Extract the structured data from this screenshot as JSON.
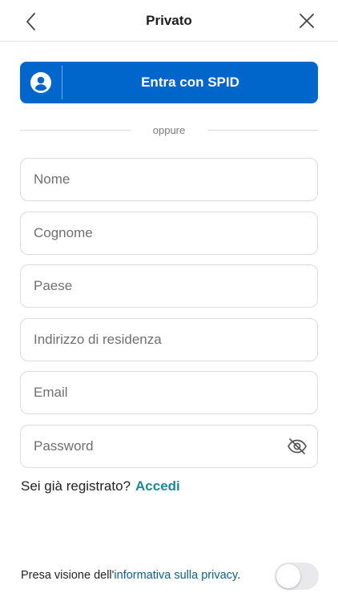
{
  "header": {
    "title": "Privato",
    "back_icon": "chevron-left-icon",
    "close_icon": "close-icon"
  },
  "spid": {
    "label": "Entra con SPID",
    "icon": "user-circle-icon",
    "color": "#0066cc"
  },
  "separator": {
    "text": "oppure"
  },
  "form": {
    "nome_placeholder": "Nome",
    "cognome_placeholder": "Cognome",
    "paese_placeholder": "Paese",
    "indirizzo_placeholder": "Indirizzo di residenza",
    "email_placeholder": "Email",
    "password_placeholder": "Password",
    "password_toggle_icon": "eye-slash-icon"
  },
  "login": {
    "prompt": "Sei già registrato?",
    "link": "Accedi"
  },
  "privacy": {
    "prefix": "Presa visione dell'",
    "link": "informativa sulla privacy",
    "suffix": ".",
    "toggle_on": false
  }
}
